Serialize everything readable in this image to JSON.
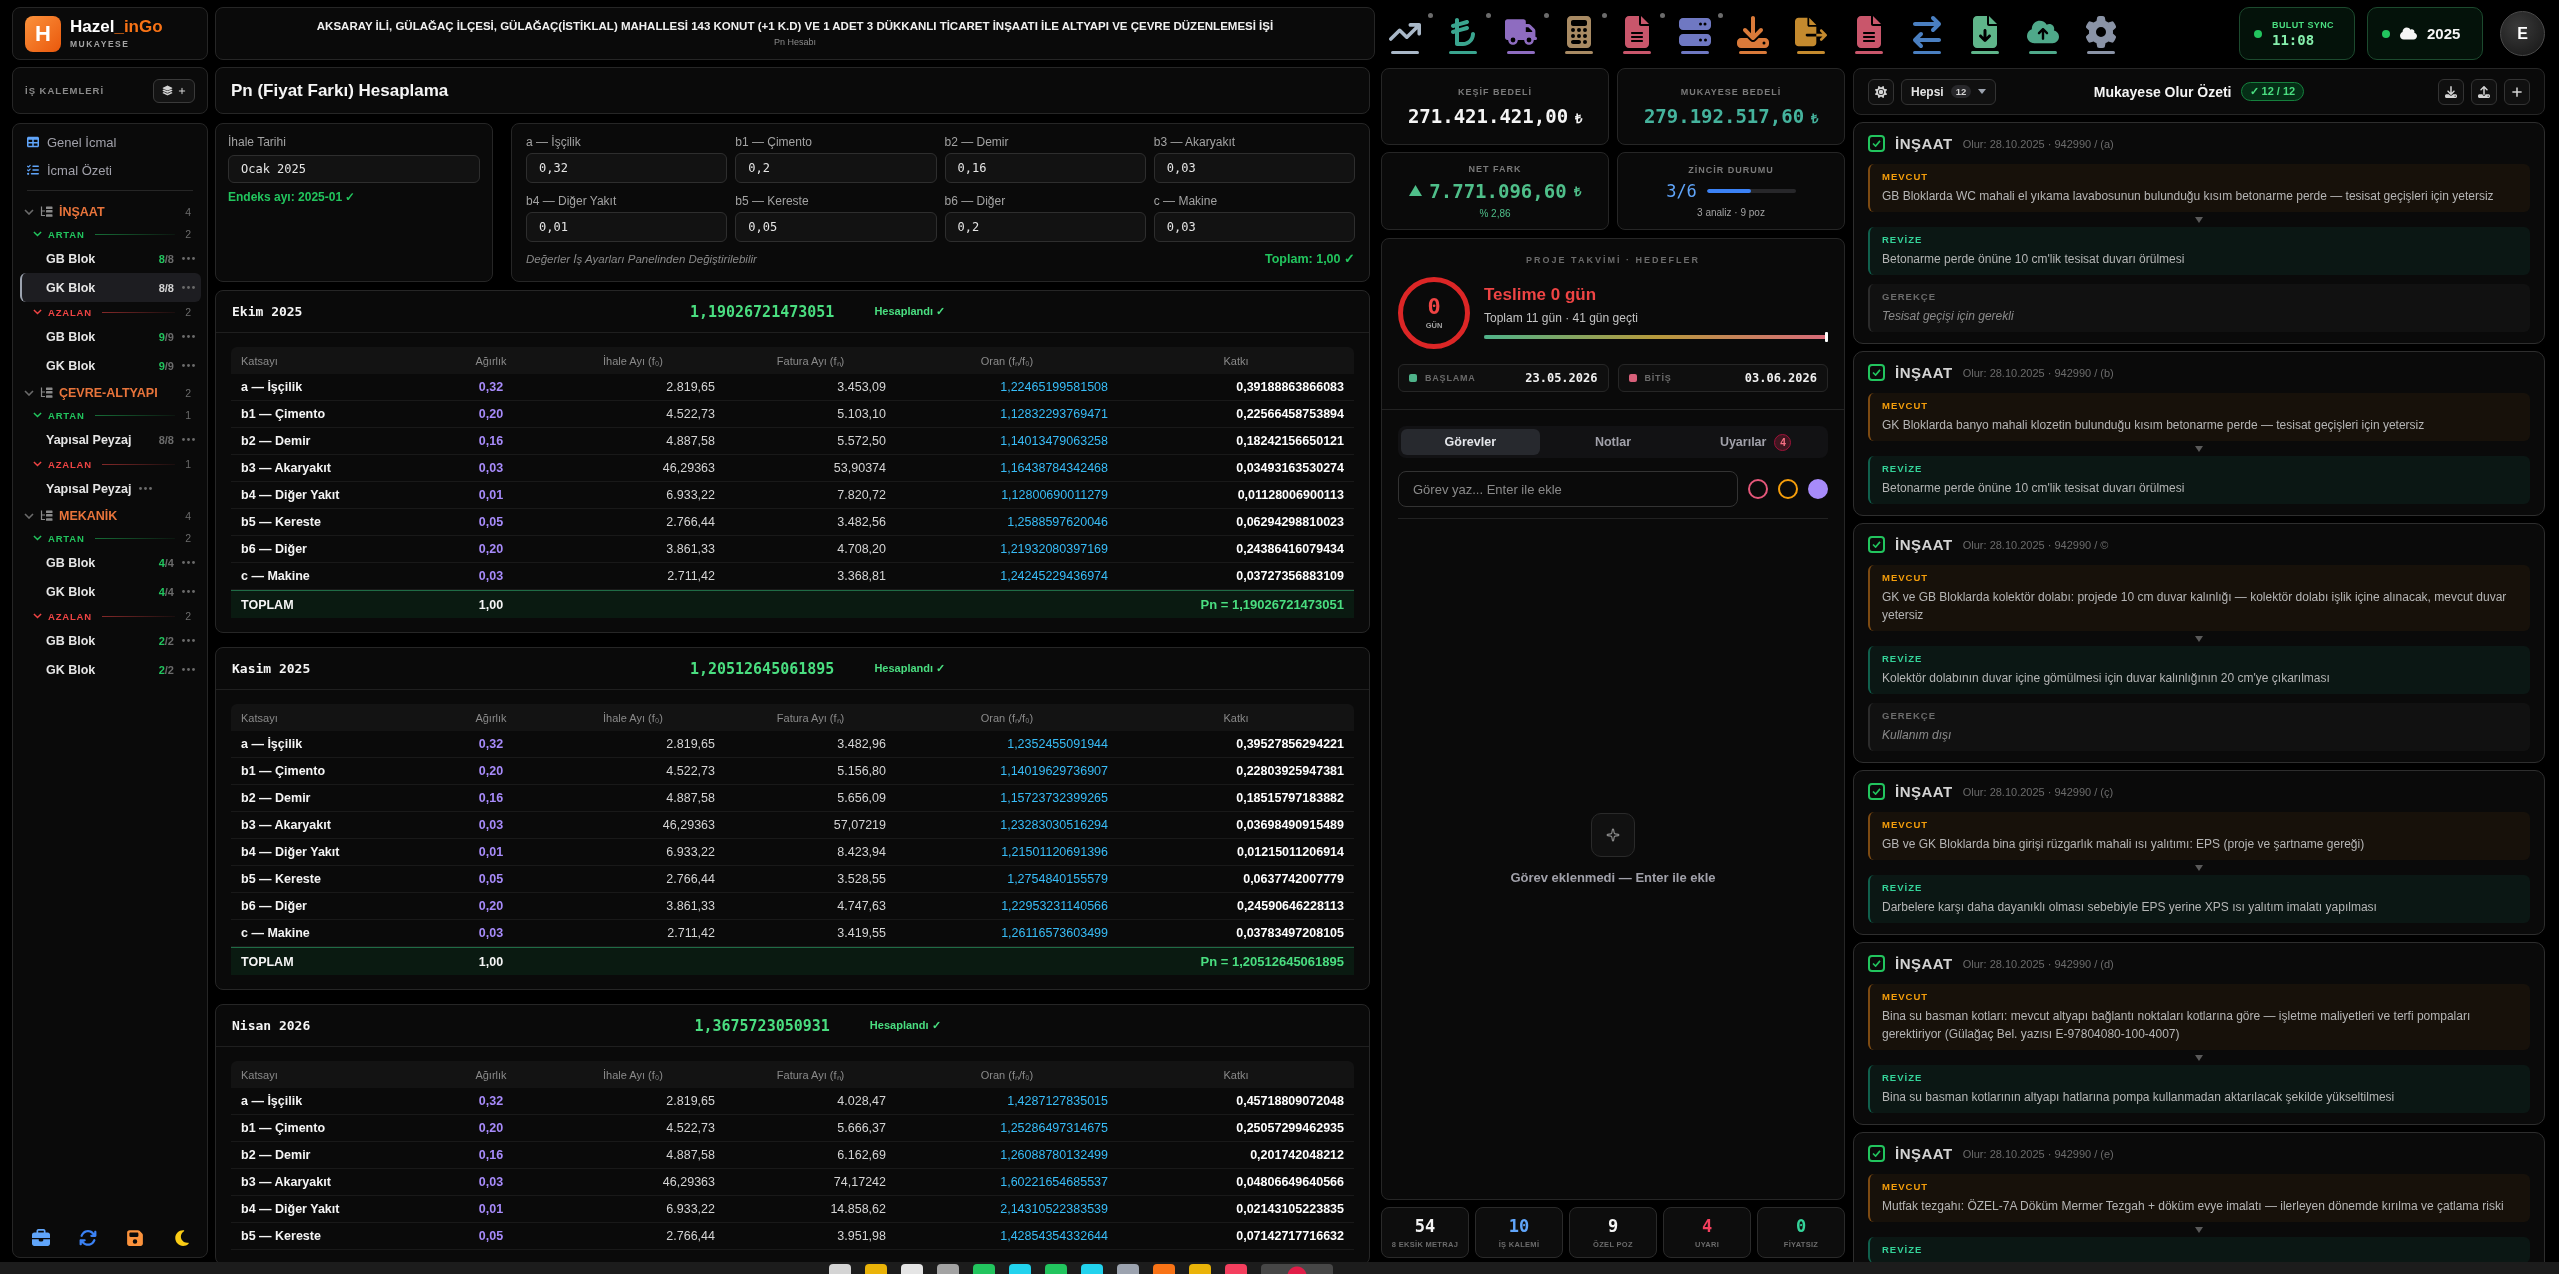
{
  "app": {
    "logo_letter": "H",
    "name": "Hazel",
    "name_accent": "_inGo",
    "subtitle": "MUKAYESE"
  },
  "header": {
    "title": "AKSARAY İLİ, GÜLAĞAÇ İLÇESİ, GÜLAĞAÇ(İSTİKLAL) MAHALLESİ 143 KONUT (+1 K.D) VE 1 ADET 3 DÜKKANLI TİCARET İNŞAATI İLE ALTYAPI VE ÇEVRE DÜZENLEMESİ İŞİ",
    "subtitle": "Pn Hesabı"
  },
  "status": {
    "sync_label": "BULUT SYNC",
    "sync_time": "11:08",
    "year": "2025",
    "avatar": "E"
  },
  "sidebar": {
    "title": "İŞ KALEMLERİ",
    "nav": [
      {
        "label": "Genel İcmal"
      },
      {
        "label": "İcmal Özeti"
      }
    ],
    "tree": [
      {
        "label": "İNŞAAT",
        "count": "4",
        "expanded": true,
        "children": [
          {
            "label": "ARTAN",
            "count": "2",
            "color": "#22c55e",
            "expanded": true,
            "children": [
              {
                "label": "GB Blok",
                "count": "8/8",
                "complete": true,
                "selected": false
              },
              {
                "label": "GK Blok",
                "count": "8/8",
                "complete": false,
                "selected": true
              }
            ]
          },
          {
            "label": "AZALAN",
            "count": "2",
            "color": "#ef4444",
            "expanded": true,
            "children": [
              {
                "label": "GB Blok",
                "count": "9/9",
                "complete": true,
                "selected": false
              },
              {
                "label": "GK Blok",
                "count": "9/9",
                "complete": true,
                "selected": false
              }
            ]
          }
        ]
      },
      {
        "label": "ÇEVRE-ALTYAPI",
        "count": "2",
        "expanded": true,
        "children": [
          {
            "label": "ARTAN",
            "count": "1",
            "color": "#22c55e",
            "expanded": true,
            "children": [
              {
                "label": "Yapısal Peyzaj",
                "count": "8/8",
                "complete": false,
                "selected": false
              }
            ]
          },
          {
            "label": "AZALAN",
            "count": "1",
            "color": "#ef4444",
            "expanded": true,
            "children": [
              {
                "label": "Yapısal Peyzaj",
                "selected": false
              }
            ]
          }
        ]
      },
      {
        "label": "MEKANİK",
        "count": "4",
        "expanded": true,
        "children": [
          {
            "label": "ARTAN",
            "count": "2",
            "color": "#22c55e",
            "expanded": true,
            "children": [
              {
                "label": "GB Blok",
                "count": "4/4",
                "complete": true,
                "selected": false
              },
              {
                "label": "GK Blok",
                "count": "4/4",
                "complete": true,
                "selected": false
              }
            ]
          },
          {
            "label": "AZALAN",
            "count": "2",
            "color": "#ef4444",
            "expanded": true,
            "children": [
              {
                "label": "GB Blok",
                "count": "2/2",
                "complete": true,
                "selected": false
              },
              {
                "label": "GK Blok",
                "count": "2/2",
                "complete": true,
                "selected": false
              }
            ]
          }
        ]
      }
    ]
  },
  "pn": {
    "title": "Pn (Fiyat Farkı) Hesaplama",
    "tender": {
      "label": "İhale Tarihi",
      "value": "Ocak 2025",
      "note": "Endeks ayı: 2025-01 ✓"
    },
    "weights": [
      {
        "label": "a — İşçilik",
        "value": "0,32"
      },
      {
        "label": "b1 — Çimento",
        "value": "0,2"
      },
      {
        "label": "b2 — Demir",
        "value": "0,16"
      },
      {
        "label": "b3 — Akaryakıt",
        "value": "0,03"
      },
      {
        "label": "b4 — Diğer Yakıt",
        "value": "0,01"
      },
      {
        "label": "b5 — Kereste",
        "value": "0,05"
      },
      {
        "label": "b6 — Diğer",
        "value": "0,2"
      },
      {
        "label": "c — Makine",
        "value": "0,03"
      }
    ],
    "hint": "Değerler İş Ayarları Panelinden Değiştirilebilir",
    "total": "Toplam: 1,00 ✓"
  },
  "periods": [
    {
      "month": "Ekim 2025",
      "pn": "1,19026721473051",
      "status": "Hesaplandı ✓",
      "columns": [
        "Katsayı",
        "Ağırlık",
        "İhale Ayı (f₀)",
        "Fatura Ayı (fₙ)",
        "Oran (fₙ/f₀)",
        "Katkı"
      ],
      "rows": [
        [
          "a — İşçilik",
          "0,32",
          "2.819,65",
          "3.453,09",
          "1,22465199581508",
          "0,39188863866083"
        ],
        [
          "b1 — Çimento",
          "0,20",
          "4.522,73",
          "5.103,10",
          "1,12832293769471",
          "0,22566458753894"
        ],
        [
          "b2 — Demir",
          "0,16",
          "4.887,58",
          "5.572,50",
          "1,14013479063258",
          "0,18242156650121"
        ],
        [
          "b3 — Akaryakıt",
          "0,03",
          "46,29363",
          "53,90374",
          "1,16438784342468",
          "0,03493163530274"
        ],
        [
          "b4 — Diğer Yakıt",
          "0,01",
          "6.933,22",
          "7.820,72",
          "1,12800690011279",
          "0,01128006900113"
        ],
        [
          "b5 — Kereste",
          "0,05",
          "2.766,44",
          "3.482,56",
          "1,2588597620046",
          "0,06294298810023"
        ],
        [
          "b6 — Diğer",
          "0,20",
          "3.861,33",
          "4.708,20",
          "1,21932080397169",
          "0,24386416079434"
        ],
        [
          "c — Makine",
          "0,03",
          "2.711,42",
          "3.368,81",
          "1,24245229436974",
          "0,03727356883109"
        ]
      ],
      "total": {
        "label": "TOPLAM",
        "weight": "1,00",
        "pn": "Pn = 1,19026721473051"
      }
    },
    {
      "month": "Kasim 2025",
      "pn": "1,20512645061895",
      "status": "Hesaplandı ✓",
      "columns": [
        "Katsayı",
        "Ağırlık",
        "İhale Ayı (f₀)",
        "Fatura Ayı (fₙ)",
        "Oran (fₙ/f₀)",
        "Katkı"
      ],
      "rows": [
        [
          "a — İşçilik",
          "0,32",
          "2.819,65",
          "3.482,96",
          "1,2352455091944",
          "0,39527856294221"
        ],
        [
          "b1 — Çimento",
          "0,20",
          "4.522,73",
          "5.156,80",
          "1,14019629736907",
          "0,22803925947381"
        ],
        [
          "b2 — Demir",
          "0,16",
          "4.887,58",
          "5.656,09",
          "1,15723732399265",
          "0,18515797183882"
        ],
        [
          "b3 — Akaryakıt",
          "0,03",
          "46,29363",
          "57,07219",
          "1,23283030516294",
          "0,03698490915489"
        ],
        [
          "b4 — Diğer Yakıt",
          "0,01",
          "6.933,22",
          "8.423,94",
          "1,21501120691396",
          "0,01215011206914"
        ],
        [
          "b5 — Kereste",
          "0,05",
          "2.766,44",
          "3.528,55",
          "1,2754840155579",
          "0,0637742007779"
        ],
        [
          "b6 — Diğer",
          "0,20",
          "3.861,33",
          "4.747,63",
          "1,22953231140566",
          "0,24590646228113"
        ],
        [
          "c — Makine",
          "0,03",
          "2.711,42",
          "3.419,55",
          "1,26116573603499",
          "0,03783497208105"
        ]
      ],
      "total": {
        "label": "TOPLAM",
        "weight": "1,00",
        "pn": "Pn = 1,20512645061895"
      }
    },
    {
      "month": "Nisan 2026",
      "pn": "1,3675723050931",
      "status": "Hesaplandı ✓",
      "columns": [
        "Katsayı",
        "Ağırlık",
        "İhale Ayı (f₀)",
        "Fatura Ayı (fₙ)",
        "Oran (fₙ/f₀)",
        "Katkı"
      ],
      "rows": [
        [
          "a — İşçilik",
          "0,32",
          "2.819,65",
          "4.028,47",
          "1,4287127835015",
          "0,45718809072048"
        ],
        [
          "b1 — Çimento",
          "0,20",
          "4.522,73",
          "5.666,37",
          "1,25286497314675",
          "0,25057299462935"
        ],
        [
          "b2 — Demir",
          "0,16",
          "4.887,58",
          "6.162,69",
          "1,26088780132499",
          "0,201742048212"
        ],
        [
          "b3 — Akaryakıt",
          "0,03",
          "46,29363",
          "74,17242",
          "1,60221654685537",
          "0,04806649640566"
        ],
        [
          "b4 — Diğer Yakıt",
          "0,01",
          "6.933,22",
          "14.858,62",
          "2,14310522383539",
          "0,02143105223835"
        ],
        [
          "b5 — Kereste",
          "0,05",
          "2.766,44",
          "3.951,98",
          "1,42854354332644",
          "0,07142717716632"
        ]
      ]
    }
  ],
  "summary": {
    "estimate": {
      "label": "KEŞİF BEDELİ",
      "value": "271.421.421,00",
      "currency": "₺"
    },
    "comparison": {
      "label": "MUKAYESE BEDELİ",
      "value": "279.192.517,60",
      "currency": "₺"
    },
    "net": {
      "label": "NET FARK",
      "increase": true,
      "value": "7.771.096,60",
      "currency": "₺",
      "percent": "% 2,86"
    },
    "chain": {
      "label": "ZİNCİR DURUMU",
      "value": "3/6",
      "level": 0.5,
      "note": "3 analiz · 9 poz"
    }
  },
  "schedule": {
    "title": "PROJE TAKVİMİ · HEDEFLER",
    "days": "0",
    "days_unit": "GÜN",
    "headline": "Teslime 0 gün",
    "detail": "Toplam 11 gün · 41 gün geçti",
    "level": 1,
    "start": {
      "label": "BAŞLAMA",
      "date": "23.05.2026"
    },
    "end": {
      "label": "BİTİŞ",
      "date": "03.06.2026"
    }
  },
  "tasks": {
    "tabs": [
      {
        "label": "Görevler",
        "selected": true
      },
      {
        "label": "Notlar",
        "selected": false
      },
      {
        "label": "Uyarılar",
        "selected": false,
        "badge": "4"
      }
    ],
    "input": {
      "placeholder": "Görev yaz... Enter ile ekle"
    },
    "colors": [
      {
        "color": "#e5577a",
        "selected": false
      },
      {
        "color": "#f59e0b",
        "selected": false
      },
      {
        "color": "#a78bfa",
        "selected": true
      }
    ],
    "empty": "Görev eklenmedi — Enter ile ekle"
  },
  "stats": [
    {
      "value": "54",
      "label": "8 EKSİK METRAJ",
      "color": "#f5f5f5"
    },
    {
      "value": "10",
      "label": "İŞ KALEMİ",
      "color": "#60a5fa"
    },
    {
      "value": "9",
      "label": "ÖZEL POZ",
      "color": "#f5f5f5"
    },
    {
      "value": "4",
      "label": "UYARI",
      "color": "#f43f5e"
    },
    {
      "value": "0",
      "label": "FİYATSIZ",
      "color": "#34d399"
    }
  ],
  "olur": {
    "filter": {
      "label": "Hepsi",
      "count": "12"
    },
    "title": "Mukayese Olur Özeti",
    "badge": "✓ 12 / 12",
    "items": [
      {
        "checked": true,
        "category": "İNŞAAT",
        "meta": "Olur: 28.10.2025 · 942990 / (a)",
        "blocks": [
          {
            "kind": "current",
            "label": "MEVCUT",
            "text": "GB Bloklarda WC mahali el yıkama lavabosunun bulunduğu kısım betonarme perde — tesisat geçişleri için yetersiz"
          },
          {
            "kind": "revised",
            "label": "REVİZE",
            "text": "Betonarme perde önüne 10 cm'lik tesisat duvarı örülmesi"
          },
          {
            "kind": "reason",
            "label": "GEREKÇE",
            "text": "Tesisat geçişi için gerekli"
          }
        ]
      },
      {
        "checked": true,
        "category": "İNŞAAT",
        "meta": "Olur: 28.10.2025 · 942990 / (b)",
        "blocks": [
          {
            "kind": "current",
            "label": "MEVCUT",
            "text": "GK Bloklarda banyo mahali klozetin bulunduğu kısım betonarme perde — tesisat geçişleri için yetersiz"
          },
          {
            "kind": "revised",
            "label": "REVİZE",
            "text": "Betonarme perde önüne 10 cm'lik tesisat duvarı örülmesi"
          }
        ]
      },
      {
        "checked": true,
        "category": "İNŞAAT",
        "meta": "Olur: 28.10.2025 · 942990 / ©",
        "blocks": [
          {
            "kind": "current",
            "label": "MEVCUT",
            "text": "GK ve GB Bloklarda kolektör dolabı: projede 10 cm duvar kalınlığı — kolektör dolabı işlik içine alınacak, mevcut duvar yetersiz"
          },
          {
            "kind": "revised",
            "label": "REVİZE",
            "text": "Kolektör dolabının duvar içine gömülmesi için duvar kalınlığının 20 cm'ye çıkarılması"
          },
          {
            "kind": "reason",
            "label": "GEREKÇE",
            "text": "Kullanım dışı"
          }
        ]
      },
      {
        "checked": true,
        "category": "İNŞAAT",
        "meta": "Olur: 28.10.2025 · 942990 / (ç)",
        "blocks": [
          {
            "kind": "current",
            "label": "MEVCUT",
            "text": "GB ve GK Bloklarda bina girişi rüzgarlık mahali ısı yalıtımı: EPS (proje ve şartname gereği)"
          },
          {
            "kind": "revised",
            "label": "REVİZE",
            "text": "Darbelere karşı daha dayanıklı olması sebebiyle EPS yerine XPS ısı yalıtım imalatı yapılması"
          }
        ]
      },
      {
        "checked": true,
        "category": "İNŞAAT",
        "meta": "Olur: 28.10.2025 · 942990 / (d)",
        "blocks": [
          {
            "kind": "current",
            "label": "MEVCUT",
            "text": "Bina su basman kotları: mevcut altyapı bağlantı noktaları kotlarına göre — işletme maliyetleri ve terfi pompaları gerektiriyor (Gülağaç Bel. yazısı E-97804080-100-4007)"
          },
          {
            "kind": "revised",
            "label": "REVİZE",
            "text": "Bina su basman kotlarının altyapı hatlarına pompa kullanmadan aktarılacak şekilde yükseltilmesi"
          }
        ]
      },
      {
        "checked": true,
        "category": "İNŞAAT",
        "meta": "Olur: 28.10.2025 · 942990 / (e)",
        "blocks": [
          {
            "kind": "current",
            "label": "MEVCUT",
            "text": "Mutfak tezgahı: ÖZEL-7A Döküm Mermer Tezgah + döküm evye imalatı — ilerleyen dönemde kırılma ve çatlama riski"
          },
          {
            "kind": "revised",
            "label": "REVİZE"
          }
        ]
      }
    ]
  }
}
